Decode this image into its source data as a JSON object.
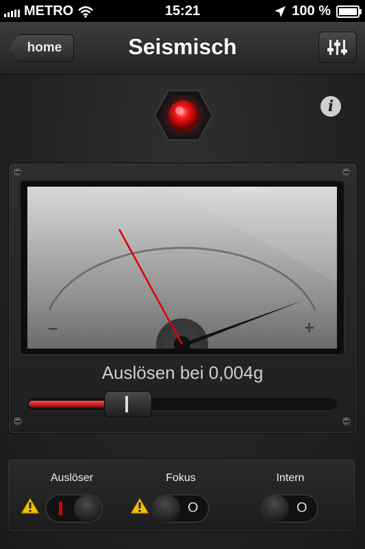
{
  "status_bar": {
    "carrier": "METRO",
    "time": "15:21",
    "battery": "100 %"
  },
  "nav": {
    "back_label": "home",
    "title": "Seismisch"
  },
  "meter": {
    "minus": "–",
    "plus": "+",
    "trigger_label": "Auslösen bei 0,004g",
    "slider_fraction": 0.3
  },
  "switches": [
    {
      "label": "Auslöser",
      "on": true,
      "warning": true,
      "off_mark": ""
    },
    {
      "label": "Fokus",
      "on": false,
      "warning": true,
      "off_mark": "O"
    },
    {
      "label": "Intern",
      "on": false,
      "warning": false,
      "off_mark": "O"
    }
  ],
  "colors": {
    "accent_red": "#e00000",
    "warning_yellow": "#f2c200"
  },
  "icons": [
    "wifi-icon",
    "location-arrow-icon",
    "battery-icon",
    "equalizer-icon",
    "info-icon",
    "warning-icon"
  ]
}
